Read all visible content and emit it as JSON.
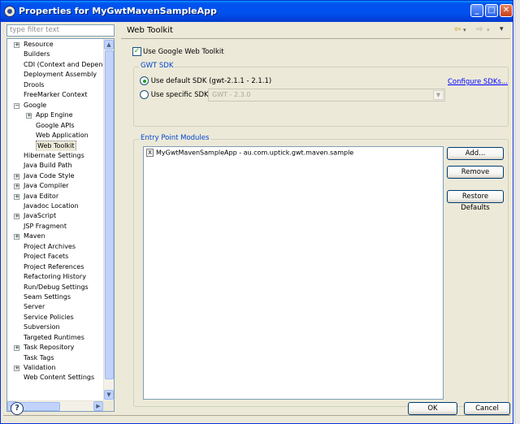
{
  "window": {
    "title": "Properties for MyGwtMavenSampleApp",
    "minimize": "_",
    "maximize": "□",
    "close": "✕"
  },
  "filter": {
    "placeholder": "type filter text"
  },
  "tree": [
    {
      "label": "Resource",
      "level": 0,
      "expander": "+",
      "selected": false
    },
    {
      "label": "Builders",
      "level": 0,
      "expander": "",
      "selected": false
    },
    {
      "label": "CDI (Context and Depend",
      "level": 0,
      "expander": "",
      "selected": false
    },
    {
      "label": "Deployment Assembly",
      "level": 0,
      "expander": "",
      "selected": false
    },
    {
      "label": "Drools",
      "level": 0,
      "expander": "",
      "selected": false
    },
    {
      "label": "FreeMarker Context",
      "level": 0,
      "expander": "",
      "selected": false
    },
    {
      "label": "Google",
      "level": 0,
      "expander": "−",
      "selected": false
    },
    {
      "label": "App Engine",
      "level": 1,
      "expander": "+",
      "selected": false
    },
    {
      "label": "Google APIs",
      "level": 1,
      "expander": "",
      "selected": false
    },
    {
      "label": "Web Application",
      "level": 1,
      "expander": "",
      "selected": false
    },
    {
      "label": "Web Toolkit",
      "level": 1,
      "expander": "",
      "selected": true
    },
    {
      "label": "Hibernate Settings",
      "level": 0,
      "expander": "",
      "selected": false
    },
    {
      "label": "Java Build Path",
      "level": 0,
      "expander": "",
      "selected": false
    },
    {
      "label": "Java Code Style",
      "level": 0,
      "expander": "+",
      "selected": false
    },
    {
      "label": "Java Compiler",
      "level": 0,
      "expander": "+",
      "selected": false
    },
    {
      "label": "Java Editor",
      "level": 0,
      "expander": "+",
      "selected": false
    },
    {
      "label": "Javadoc Location",
      "level": 0,
      "expander": "",
      "selected": false
    },
    {
      "label": "JavaScript",
      "level": 0,
      "expander": "+",
      "selected": false
    },
    {
      "label": "JSP Fragment",
      "level": 0,
      "expander": "",
      "selected": false
    },
    {
      "label": "Maven",
      "level": 0,
      "expander": "+",
      "selected": false
    },
    {
      "label": "Project Archives",
      "level": 0,
      "expander": "",
      "selected": false
    },
    {
      "label": "Project Facets",
      "level": 0,
      "expander": "",
      "selected": false
    },
    {
      "label": "Project References",
      "level": 0,
      "expander": "",
      "selected": false
    },
    {
      "label": "Refactoring History",
      "level": 0,
      "expander": "",
      "selected": false
    },
    {
      "label": "Run/Debug Settings",
      "level": 0,
      "expander": "",
      "selected": false
    },
    {
      "label": "Seam Settings",
      "level": 0,
      "expander": "",
      "selected": false
    },
    {
      "label": "Server",
      "level": 0,
      "expander": "",
      "selected": false
    },
    {
      "label": "Service Policies",
      "level": 0,
      "expander": "",
      "selected": false
    },
    {
      "label": "Subversion",
      "level": 0,
      "expander": "",
      "selected": false
    },
    {
      "label": "Targeted Runtimes",
      "level": 0,
      "expander": "",
      "selected": false
    },
    {
      "label": "Task Repository",
      "level": 0,
      "expander": "+",
      "selected": false
    },
    {
      "label": "Task Tags",
      "level": 0,
      "expander": "",
      "selected": false
    },
    {
      "label": "Validation",
      "level": 0,
      "expander": "+",
      "selected": false
    },
    {
      "label": "Web Content Settings",
      "level": 0,
      "expander": "",
      "selected": false
    }
  ],
  "page": {
    "title": "Web Toolkit",
    "back_icon": "⇦",
    "forward_icon": "⇨",
    "menu_icon": "▾",
    "use_gwt_label": "Use Google Web Toolkit",
    "use_gwt_checked": true
  },
  "sdk": {
    "legend": "GWT SDK",
    "default_label": "Use default SDK (gwt-2.1.1 - 2.1.1)",
    "specific_label": "Use specific SDK:",
    "specific_value": "GWT - 2.3.0",
    "configure_link": "Configure SDKs..."
  },
  "entry_points": {
    "legend": "Entry Point Modules",
    "modules": [
      "MyGwtMavenSampleApp - au.com.uptick.gwt.maven.sample"
    ],
    "add_label": "Add...",
    "remove_label": "Remove",
    "restore_label": "Restore Defaults"
  },
  "footer": {
    "help_label": "?",
    "ok_label": "OK",
    "cancel_label": "Cancel"
  },
  "colors": {
    "title_bar": "#0054e3",
    "link": "#0000ff",
    "group_legend": "#0046d5"
  }
}
